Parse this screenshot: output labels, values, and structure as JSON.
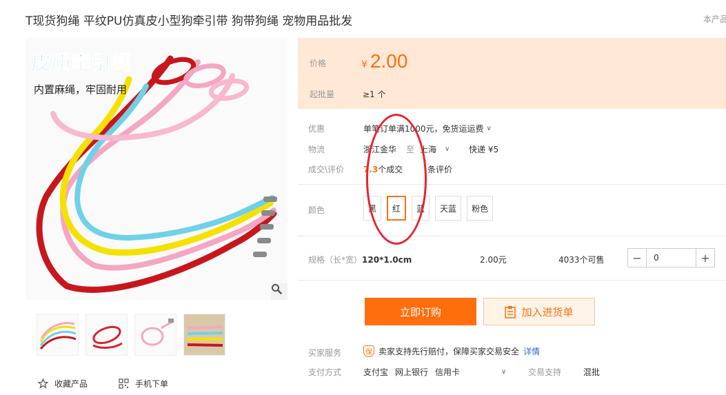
{
  "product": {
    "title": "T现货狗绳 平纹PU仿真皮小型狗牵引带 狗带狗绳 宠物用品批发",
    "corner_note": "本产品"
  },
  "main_image": {
    "banner_text": "皮质牵引绳",
    "sub_text": "内置麻绳，牢固耐用",
    "zoom_icon": "magnifier-icon"
  },
  "thumbnails": [
    "thumb-1",
    "thumb-2",
    "thumb-3",
    "thumb-4"
  ],
  "bottom_links": {
    "favorite": "收藏产品",
    "mobile_order": "手机下单"
  },
  "price": {
    "label": "价格",
    "currency": "¥",
    "value": "2.00",
    "moq_label": "起批量",
    "moq_value": "≥1 个"
  },
  "promo": {
    "label": "优惠",
    "text": "单笔订单满1000元，免货运运费"
  },
  "logistics": {
    "label": "物流",
    "from": "浙江金华",
    "to_word": "至",
    "to": "上海",
    "method": "快递 ¥5"
  },
  "deals": {
    "label": "成交\\评价",
    "count": "7.3",
    "count_suffix": "个成交",
    "reviews_suffix": "条评价"
  },
  "colors": {
    "label": "颜色",
    "options": [
      "黑",
      "红",
      "蓝",
      "天蓝",
      "粉色"
    ],
    "selected_index": 1
  },
  "spec": {
    "label": "规格（长*宽）",
    "value": "120*1.0cm",
    "price": "2.00元",
    "stock": "4033个可售",
    "quantity": "0"
  },
  "actions": {
    "buy_now": "立即订购",
    "add_to_list": "加入进货单"
  },
  "buyer_service": {
    "label": "买家服务",
    "badge": "保",
    "text": "卖家支持先行赔付，保障买家交易安全",
    "link": "详情"
  },
  "payment": {
    "label": "支付方式",
    "methods": [
      "支付宝",
      "网上银行",
      "信用卡"
    ],
    "trade_label": "交易支持",
    "trade_value": "混批"
  },
  "colors_palette": {
    "accent": "#ff6e0c",
    "price_bg": "#ffe8d6",
    "annotation": "#e8222d"
  }
}
